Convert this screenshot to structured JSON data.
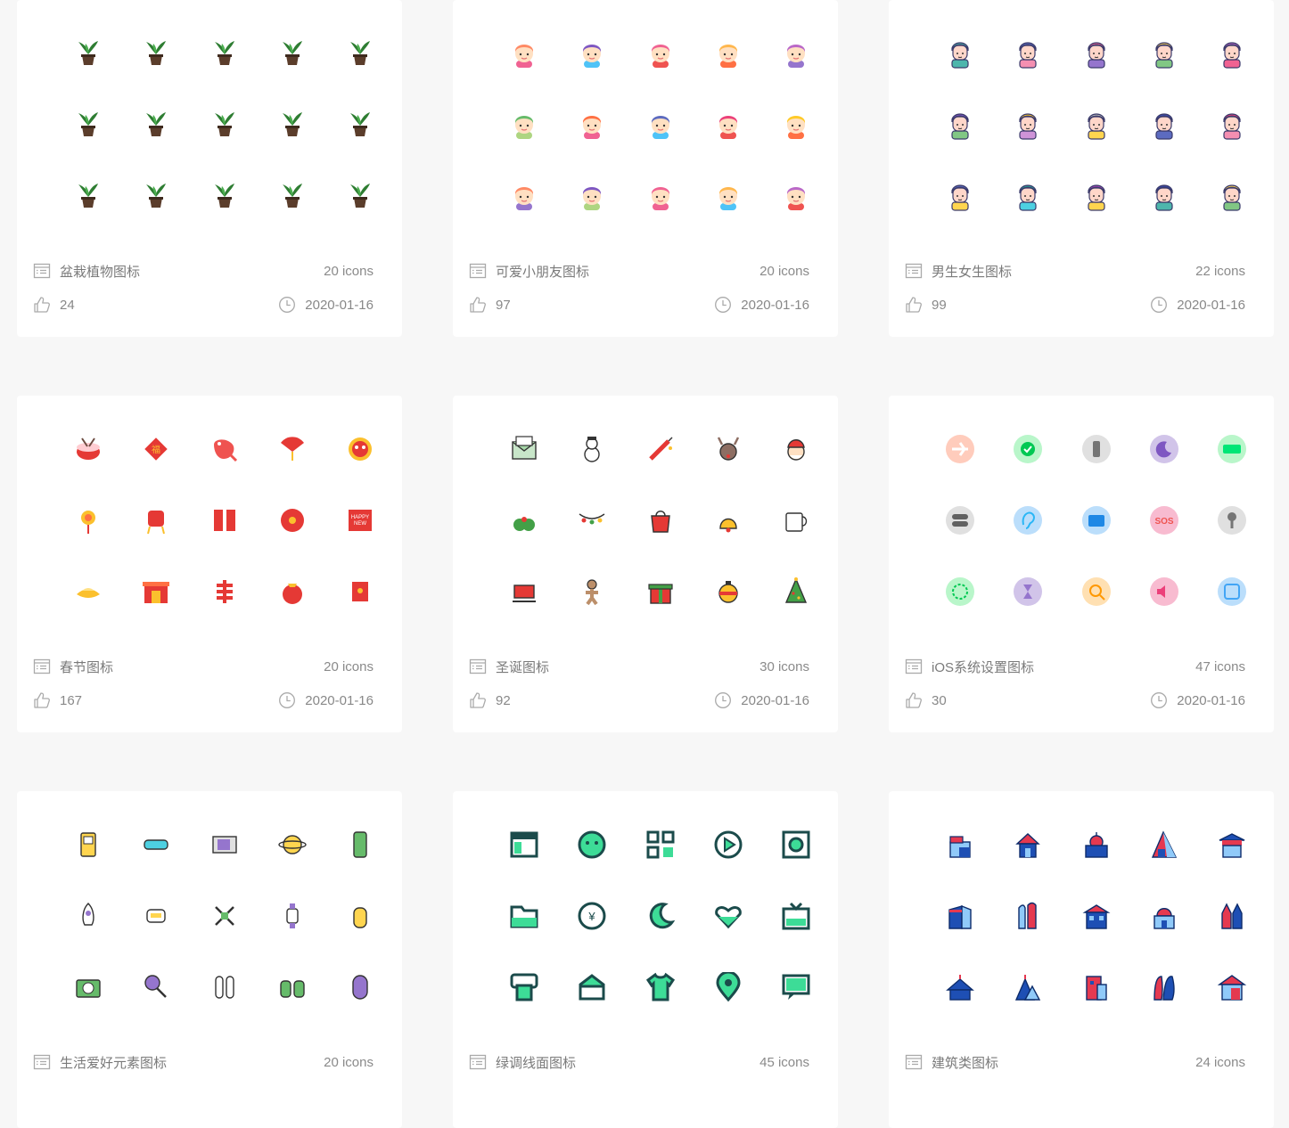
{
  "cards": [
    {
      "title": "盆栽植物图标",
      "count": "20 icons",
      "likes": "24",
      "date": "2020-01-16",
      "icon_set": "potted-plants",
      "palette": [
        "#2e7d32",
        "#5b3d2b",
        "#4caf50"
      ]
    },
    {
      "title": "可爱小朋友图标",
      "count": "20 icons",
      "likes": "97",
      "date": "2020-01-16",
      "icon_set": "cute-kids",
      "palette": [
        "#ff8a65",
        "#ffe0c2",
        "#7e57c2",
        "#4fc3f7",
        "#f06292",
        "#66bb6a"
      ]
    },
    {
      "title": "男生女生图标",
      "count": "22 icons",
      "likes": "99",
      "date": "2020-01-16",
      "icon_set": "boys-girls",
      "palette": [
        "#5c6bc0",
        "#f48fb1",
        "#81c784",
        "#ba68c8",
        "#ffd54f"
      ]
    },
    {
      "title": "春节图标",
      "count": "20 icons",
      "likes": "167",
      "date": "2020-01-16",
      "icon_set": "spring-festival",
      "palette": [
        "#e53935",
        "#fbc02d",
        "#ff7043"
      ]
    },
    {
      "title": "圣诞图标",
      "count": "30 icons",
      "likes": "92",
      "date": "2020-01-16",
      "icon_set": "christmas",
      "palette": [
        "#e53935",
        "#43a047",
        "#fbc02d",
        "#8d6e63"
      ]
    },
    {
      "title": "iOS系统设置图标",
      "count": "47 icons",
      "likes": "30",
      "date": "2020-01-16",
      "icon_set": "ios-settings",
      "palette": [
        "#ffccbc",
        "#b9f6ca",
        "#e0e0e0",
        "#d1c4e9",
        "#bbdefb",
        "#f8bbd0",
        "#ffe0b2"
      ]
    },
    {
      "title": "生活爱好元素图标",
      "count": "20 icons",
      "likes": "",
      "date": "",
      "icon_set": "hobbies",
      "palette": [
        "#ffd54f",
        "#4dd0e1",
        "#9575cd",
        "#66bb6a"
      ]
    },
    {
      "title": "绿调线面图标",
      "count": "45 icons",
      "likes": "",
      "date": "",
      "icon_set": "green-line-fill",
      "palette": [
        "#1b4b4b",
        "#3ddc97"
      ]
    },
    {
      "title": "建筑类图标",
      "count": "24 icons",
      "likes": "",
      "date": "",
      "icon_set": "buildings",
      "palette": [
        "#1e4fb4",
        "#e53950",
        "#90caf9"
      ]
    }
  ]
}
